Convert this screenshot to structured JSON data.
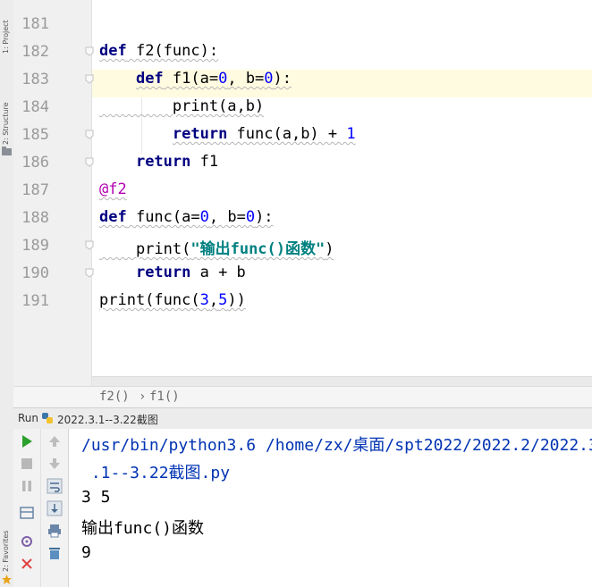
{
  "editor": {
    "current_line": "183",
    "lines": [
      {
        "num": "181"
      },
      {
        "num": "182",
        "t": [
          [
            "def",
            "kw"
          ],
          " f2(func):"
        ]
      },
      {
        "num": "183",
        "t": [
          "    ",
          [
            "def",
            "kw"
          ],
          " f1(a=",
          [
            "0",
            "num"
          ],
          ", b=",
          [
            "0",
            "num"
          ],
          "):"
        ]
      },
      {
        "num": "184",
        "t": [
          "        print(a,b)"
        ]
      },
      {
        "num": "185",
        "t": [
          "        ",
          [
            "return",
            "kw"
          ],
          " func(a,b) + ",
          [
            "1",
            "num"
          ]
        ]
      },
      {
        "num": "186",
        "t": [
          "    ",
          [
            "return",
            "kw"
          ],
          " f1"
        ]
      },
      {
        "num": "187",
        "t": [
          [
            "@f2",
            "deco"
          ]
        ]
      },
      {
        "num": "188",
        "t": [
          [
            "def",
            "kw"
          ],
          " func(a=",
          [
            "0",
            "num"
          ],
          ", b=",
          [
            "0",
            "num"
          ],
          "):"
        ]
      },
      {
        "num": "189",
        "t": [
          "    print(",
          [
            "\"输出func()函数\"",
            "str"
          ],
          ")"
        ]
      },
      {
        "num": "190",
        "t": [
          "    ",
          [
            "return",
            "kw"
          ],
          " a + b"
        ]
      },
      {
        "num": "191",
        "t": [
          "print(func(",
          [
            "3",
            "num"
          ],
          ",",
          [
            "5",
            "num"
          ],
          "))"
        ]
      }
    ]
  },
  "breadcrumb": {
    "item1": "f2()",
    "sep": "›",
    "item2": "f1()"
  },
  "run": {
    "label": "Run",
    "config": "2022.3.1--3.22截图"
  },
  "console": {
    "lines": [
      {
        "text": "/usr/bin/python3.6 /home/zx/桌面/spt2022/2022.2/2022.3",
        "cls": "path"
      },
      {
        "text": " .1--3.22截图.py",
        "cls": "path"
      },
      {
        "text": "3 5",
        "cls": ""
      },
      {
        "text": "输出func()函数",
        "cls": ""
      },
      {
        "text": "9",
        "cls": ""
      }
    ]
  },
  "sidebar": {
    "label_top": "1: Project",
    "label_mid": "2: Structure",
    "label_bottom": "2: Favorites"
  },
  "colors": {
    "keyword": "#000080",
    "number": "#0000ff",
    "decorator": "#b200b2",
    "string": "#008080",
    "path": "#0033b3",
    "run_green": "#2ca02c",
    "stop_red": "#e04040"
  }
}
